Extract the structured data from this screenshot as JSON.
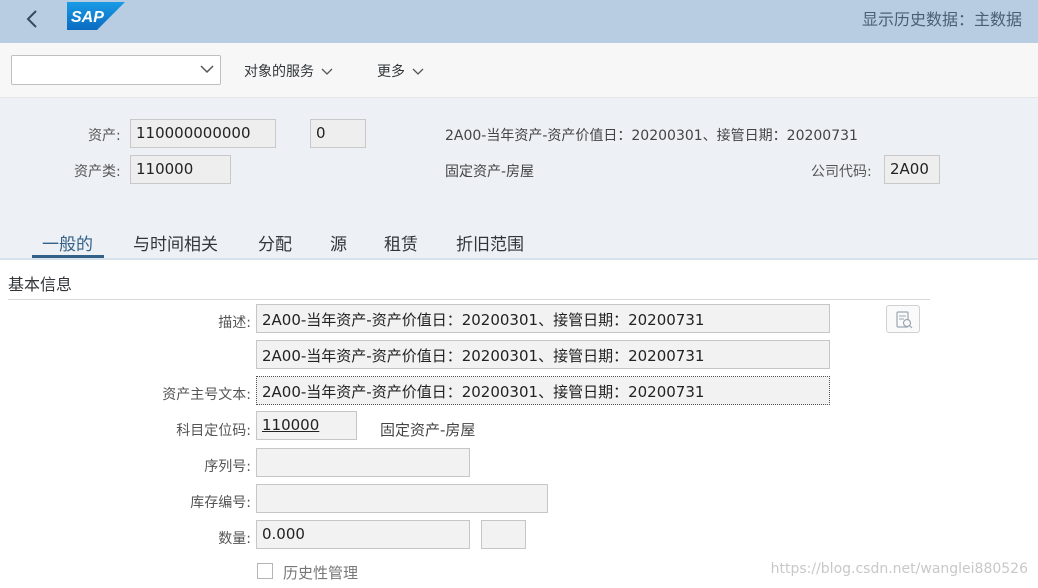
{
  "shell": {
    "title": "显示历史数据：主数据",
    "logo_text": "SAP"
  },
  "toolbar": {
    "select_value": "",
    "services_label": "对象的服务",
    "more_label": "更多"
  },
  "header": {
    "asset_label": "资产:",
    "asset_number": "110000000000",
    "sub_number": "0",
    "asset_description": "2A00-当年资产-资产价值日：20200301、接管日期：20200731",
    "asset_class_label": "资产类:",
    "asset_class": "110000",
    "asset_class_text": "固定资产-房屋",
    "company_code_label": "公司代码:",
    "company_code": "2A00"
  },
  "tabs": [
    {
      "label": "一般的",
      "active": true
    },
    {
      "label": "与时间相关",
      "active": false
    },
    {
      "label": "分配",
      "active": false
    },
    {
      "label": "源",
      "active": false
    },
    {
      "label": "租赁",
      "active": false
    },
    {
      "label": "折旧范围",
      "active": false
    }
  ],
  "general": {
    "section_title": "基本信息",
    "description_label": "描述:",
    "description_1": "2A00-当年资产-资产价值日：20200301、接管日期：20200731",
    "description_2": "2A00-当年资产-资产价值日：20200301、接管日期：20200731",
    "main_text_label": "资产主号文本:",
    "main_text": "2A00-当年资产-资产价值日：20200301、接管日期：20200731",
    "account_det_label": "科目定位码:",
    "account_det": "110000",
    "account_det_text": "固定资产-房屋",
    "serial_label": "序列号:",
    "serial": "",
    "inventory_label": "库存编号:",
    "inventory": "",
    "quantity_label": "数量:",
    "quantity": "0.000",
    "unit": "",
    "history_label": "历史性管理",
    "history_checked": false
  },
  "watermark": "https://blog.csdn.net/wanglei880526",
  "colors": {
    "shellbar": "#b8cde2",
    "header_bg": "#edf1f5",
    "active_tab": "#346187"
  }
}
